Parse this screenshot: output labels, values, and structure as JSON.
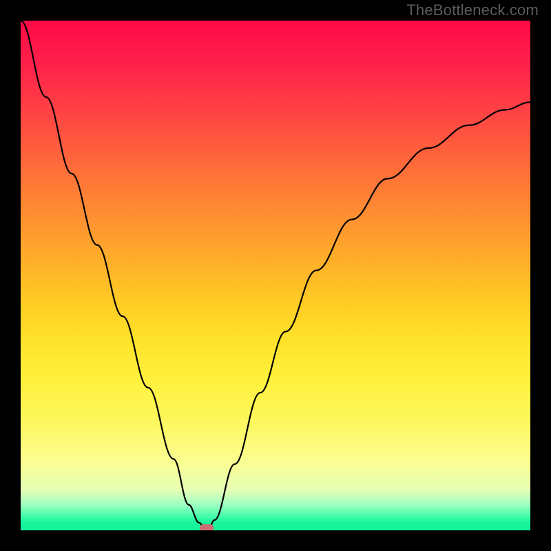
{
  "watermark": "TheBottleneck.com",
  "chart_data": {
    "type": "line",
    "title": "",
    "xlabel": "",
    "ylabel": "",
    "xlim": [
      0,
      100
    ],
    "ylim": [
      0,
      100
    ],
    "series": [
      {
        "name": "curve",
        "x": [
          0,
          5,
          10,
          15,
          20,
          25,
          30,
          33,
          35,
          36,
          37,
          38,
          42,
          47,
          52,
          58,
          65,
          72,
          80,
          88,
          95,
          100
        ],
        "y": [
          100,
          85,
          70,
          56,
          42,
          28,
          14,
          5,
          1.5,
          0.6,
          0.6,
          2,
          13,
          27,
          39,
          51,
          61,
          69,
          75,
          79.5,
          82.5,
          84
        ]
      }
    ],
    "minimum_marker": {
      "x": 36.5,
      "y": 0.5,
      "color": "#cd6d70"
    },
    "gradient_stops": [
      {
        "pos": 0.0,
        "color": "#ff0a47"
      },
      {
        "pos": 0.5,
        "color": "#ffd626"
      },
      {
        "pos": 0.92,
        "color": "#e8ffb0"
      },
      {
        "pos": 1.0,
        "color": "#10f499"
      }
    ]
  }
}
